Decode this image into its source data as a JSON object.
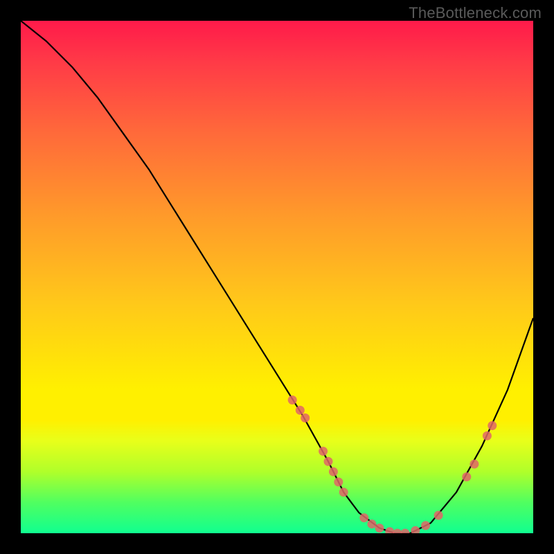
{
  "watermark": "TheBottleneck.com",
  "chart_data": {
    "type": "line",
    "title": "",
    "xlabel": "",
    "ylabel": "",
    "xlim": [
      0,
      100
    ],
    "ylim": [
      0,
      100
    ],
    "grid": false,
    "legend": false,
    "series": [
      {
        "name": "curve",
        "x": [
          0,
          5,
          10,
          15,
          20,
          25,
          30,
          35,
          40,
          45,
          50,
          55,
          60,
          63,
          66,
          70,
          73,
          76,
          80,
          85,
          90,
          95,
          100
        ],
        "y": [
          100,
          96,
          91,
          85,
          78,
          71,
          63,
          55,
          47,
          39,
          31,
          23,
          14,
          8,
          4,
          1,
          0,
          0,
          2,
          8,
          17,
          28,
          42
        ]
      }
    ],
    "markers": [
      {
        "name": "left-cluster-1",
        "x": 53,
        "y": 26
      },
      {
        "name": "left-cluster-2",
        "x": 54.5,
        "y": 24
      },
      {
        "name": "left-cluster-3",
        "x": 55.5,
        "y": 22.5
      },
      {
        "name": "left-cluster-4",
        "x": 59,
        "y": 16
      },
      {
        "name": "left-cluster-5",
        "x": 60,
        "y": 14
      },
      {
        "name": "left-cluster-6",
        "x": 61,
        "y": 12
      },
      {
        "name": "left-cluster-7",
        "x": 62,
        "y": 10
      },
      {
        "name": "left-cluster-8",
        "x": 63,
        "y": 8
      },
      {
        "name": "bottom-1",
        "x": 67,
        "y": 3
      },
      {
        "name": "bottom-2",
        "x": 68.5,
        "y": 1.8
      },
      {
        "name": "bottom-3",
        "x": 70,
        "y": 1
      },
      {
        "name": "bottom-4",
        "x": 72,
        "y": 0.3
      },
      {
        "name": "bottom-5",
        "x": 73.5,
        "y": 0
      },
      {
        "name": "bottom-6",
        "x": 75,
        "y": 0
      },
      {
        "name": "bottom-7",
        "x": 77,
        "y": 0.5
      },
      {
        "name": "bottom-8",
        "x": 79,
        "y": 1.5
      },
      {
        "name": "bottom-9",
        "x": 81.5,
        "y": 3.5
      },
      {
        "name": "right-cluster-1",
        "x": 87,
        "y": 11
      },
      {
        "name": "right-cluster-2",
        "x": 88.5,
        "y": 13.5
      },
      {
        "name": "right-cluster-3",
        "x": 91,
        "y": 19
      },
      {
        "name": "right-cluster-4",
        "x": 92,
        "y": 21
      }
    ],
    "colors": {
      "curve": "#000000",
      "marker_fill": "#e06666",
      "marker_stroke": "#e06666"
    }
  }
}
